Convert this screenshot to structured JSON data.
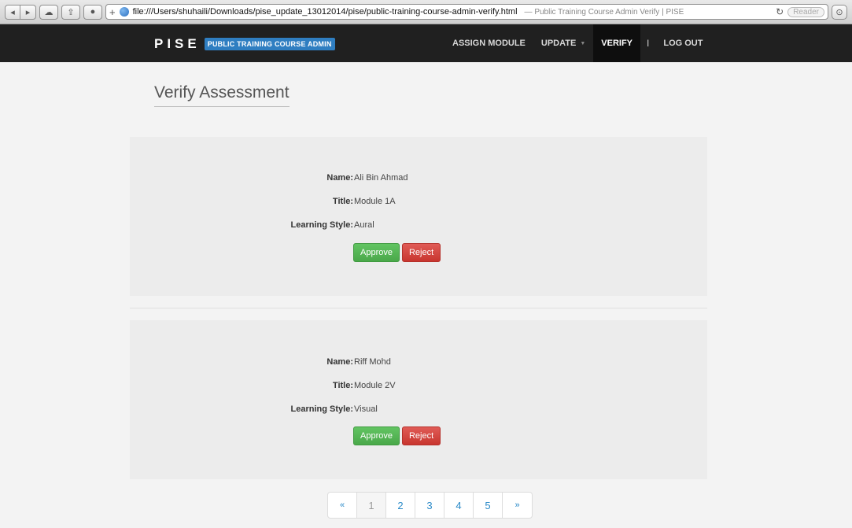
{
  "browser": {
    "url": "file:///Users/shuhaili/Downloads/pise_update_13012014/pise/public-training-course-admin-verify.html",
    "page_title": "— Public Training Course Admin Verify | PISE",
    "reader_label": "Reader"
  },
  "navbar": {
    "brand": "PISE",
    "badge": "PUBLIC TRAINING COURSE ADMIN",
    "items": [
      {
        "label": "ASSIGN MODULE"
      },
      {
        "label": "UPDATE"
      },
      {
        "label": "VERIFY"
      },
      {
        "label": "LOG OUT"
      }
    ],
    "separator": "I"
  },
  "page": {
    "title": "Verify Assessment"
  },
  "labels": {
    "name": "Name:",
    "title": "Title:",
    "learning_style": "Learning Style:",
    "approve": "Approve",
    "reject": "Reject"
  },
  "assessments": [
    {
      "name": "Ali Bin Ahmad",
      "title": "Module 1A",
      "learning_style": "Aural"
    },
    {
      "name": "Riff Mohd",
      "title": "Module 2V",
      "learning_style": "Visual"
    }
  ],
  "pagination": {
    "prev": "«",
    "pages": [
      "1",
      "2",
      "3",
      "4",
      "5"
    ],
    "next": "»",
    "current": "1"
  }
}
